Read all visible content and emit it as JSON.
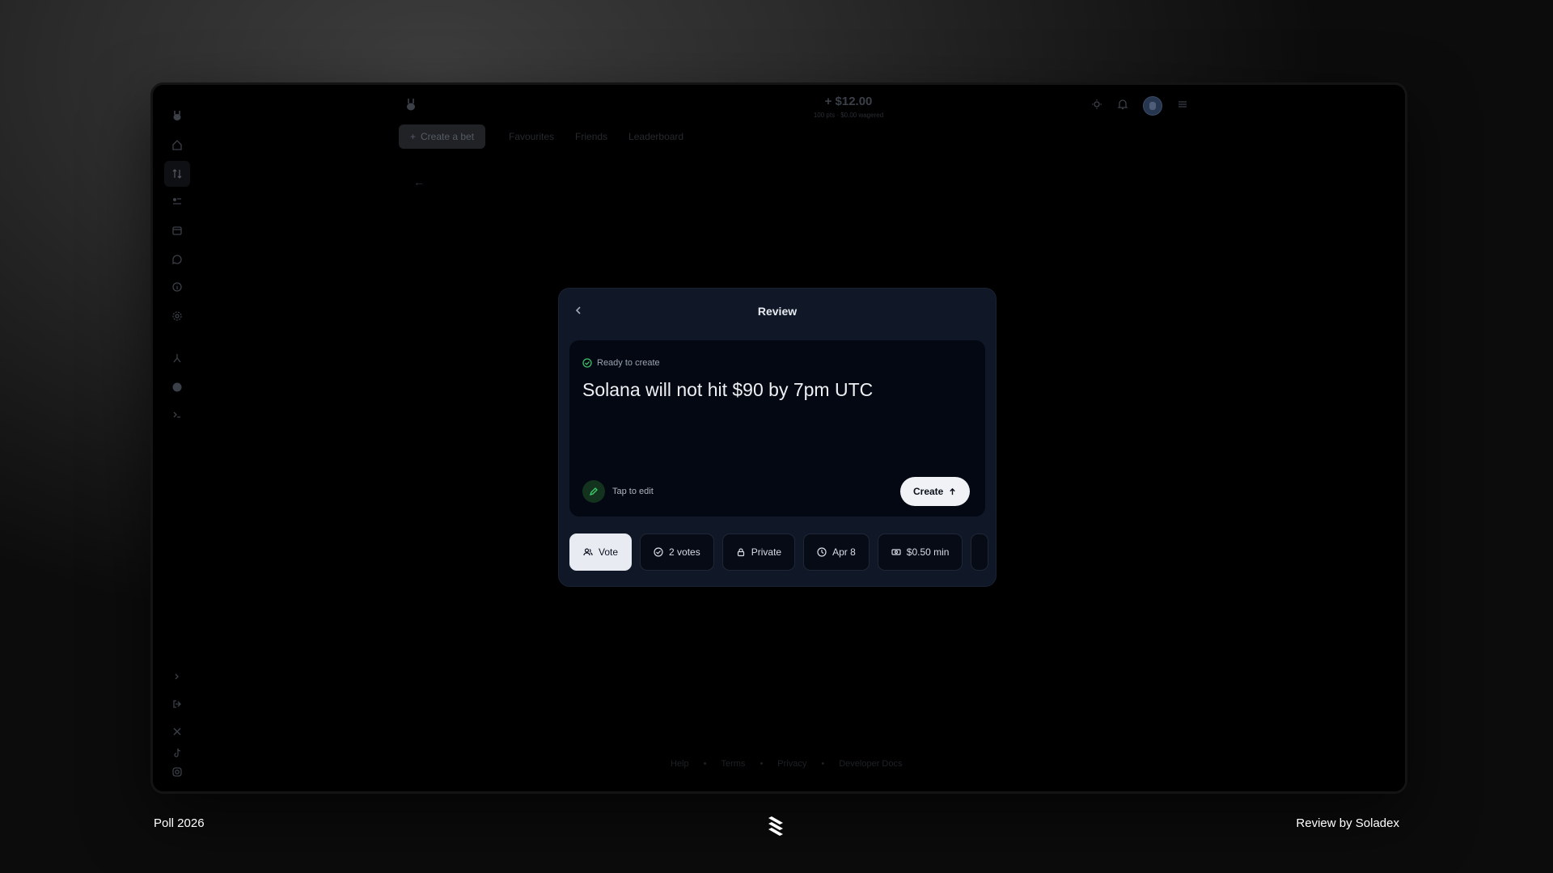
{
  "app": {
    "balance": "+ $12.00",
    "balance_sub": "100 pts · $0.00 wagered",
    "create_bet_label": "Create a bet",
    "nav": [
      "Favourites",
      "Friends",
      "Leaderboard"
    ],
    "footer_links": [
      "Help",
      "Terms",
      "Privacy",
      "Developer Docs"
    ]
  },
  "modal": {
    "title": "Review",
    "status": "Ready to create",
    "headline": "Solana will not hit $90 by 7pm UTC",
    "edit_label": "Tap to edit",
    "create_label": "Create",
    "chips": [
      {
        "icon": "users-icon",
        "label": "Vote",
        "selected": true
      },
      {
        "icon": "check-circle-icon",
        "label": "2 votes"
      },
      {
        "icon": "lock-icon",
        "label": "Private"
      },
      {
        "icon": "clock-icon",
        "label": "Apr 8"
      },
      {
        "icon": "cash-icon",
        "label": "$0.50 min"
      }
    ]
  },
  "caption": {
    "left": "Poll 2026",
    "right": "Review by Soladex"
  },
  "colors": {
    "modal_bg": "#101828",
    "card_bg": "#040812",
    "accent_green": "#3fbf6a",
    "chip_selected": "#e8ebf2"
  }
}
